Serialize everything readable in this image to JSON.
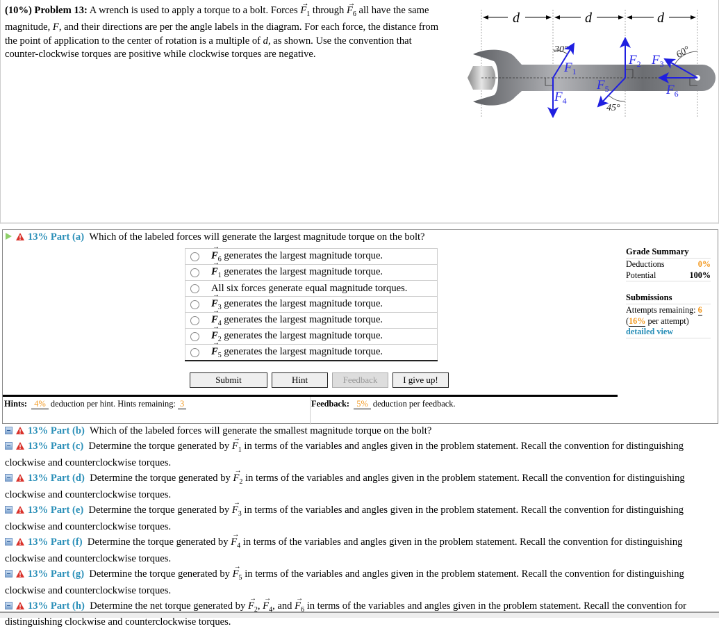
{
  "problem": {
    "prefix": "(10%) Problem 13:",
    "line1_a": "A wrench is used to apply a torque to a bolt. Forces",
    "line1_b": "through",
    "line1_c": "all have the same magnitude,",
    "line1_d": ", and their directions are per the angle labels in the diagram. For each force, the distance from the point of application to the center of rotation is a multiple of",
    "line1_e": ", as shown. Use the convention that counter-clockwise torques are positive while clockwise torques are negative.",
    "var_F": "F",
    "var_d": "d",
    "F1": "F",
    "F1_sub": "1",
    "F6": "F",
    "F6_sub": "6"
  },
  "diagram": {
    "distance_labels": [
      "d",
      "d",
      "d"
    ],
    "angles": [
      "30°",
      "45°",
      "60°"
    ],
    "forces": [
      {
        "label": "F",
        "sub": "1"
      },
      {
        "label": "F",
        "sub": "2"
      },
      {
        "label": "F",
        "sub": "3"
      },
      {
        "label": "F",
        "sub": "4"
      },
      {
        "label": "F",
        "sub": "5"
      },
      {
        "label": "F",
        "sub": "6"
      }
    ],
    "colors": {
      "force": "#1f1fe0",
      "wrench": "#8a8c90"
    }
  },
  "part_a": {
    "percent": "13%",
    "label": "Part (a)",
    "question": "Which of the labeled forces will generate the largest magnitude torque on the bolt?",
    "choices": [
      {
        "vec": "F",
        "sub": "6",
        "text": " generates the largest magnitude torque."
      },
      {
        "vec": "F",
        "sub": "1",
        "text": " generates the largest magnitude torque."
      },
      {
        "vec": "",
        "sub": "",
        "text": "All six forces generate equal magnitude torques."
      },
      {
        "vec": "F",
        "sub": "3",
        "text": " generates the largest magnitude torque."
      },
      {
        "vec": "F",
        "sub": "4",
        "text": " generates the largest magnitude torque."
      },
      {
        "vec": "F",
        "sub": "2",
        "text": " generates the largest magnitude torque."
      },
      {
        "vec": "F",
        "sub": "5",
        "text": " generates the largest magnitude torque."
      }
    ],
    "buttons": {
      "submit": "Submit",
      "hint": "Hint",
      "feedback": "Feedback",
      "give_up": "I give up!"
    },
    "hints": {
      "label": "Hints:",
      "deduction": "4%",
      "text": "deduction per hint. Hints remaining:",
      "remaining": "3"
    },
    "feedback": {
      "label": "Feedback:",
      "deduction": "5%",
      "text": "deduction per feedback."
    }
  },
  "grade_summary": {
    "title": "Grade Summary",
    "deductions_label": "Deductions",
    "deductions_value": "0%",
    "potential_label": "Potential",
    "potential_value": "100%",
    "submissions_title": "Submissions",
    "attempts_label": "Attempts remaining:",
    "attempts_value": "6",
    "per_attempt_open": "(",
    "per_attempt_value": "16%",
    "per_attempt_text": " per attempt)",
    "detailed_view": "detailed view"
  },
  "other_parts": [
    {
      "percent": "13%",
      "label": "Part (b)",
      "pre": "Which of the labeled forces will generate the smallest magnitude torque on the bolt?",
      "vecs": [],
      "post": ""
    },
    {
      "percent": "13%",
      "label": "Part (c)",
      "pre": "Determine the torque generated by",
      "vecs": [
        "1"
      ],
      "post": "in terms of the variables and angles given in the problem statement. Recall the convention for distinguishing clockwise and counterclockwise torques."
    },
    {
      "percent": "13%",
      "label": "Part (d)",
      "pre": "Determine the torque generated by",
      "vecs": [
        "2"
      ],
      "post": "in terms of the variables and angles given in the problem statement. Recall the convention for distinguishing clockwise and counterclockwise torques."
    },
    {
      "percent": "13%",
      "label": "Part (e)",
      "pre": "Determine the torque generated by",
      "vecs": [
        "3"
      ],
      "post": "in terms of the variables and angles given in the problem statement. Recall the convention for distinguishing clockwise and counterclockwise torques."
    },
    {
      "percent": "13%",
      "label": "Part (f)",
      "pre": "Determine the torque generated by",
      "vecs": [
        "4"
      ],
      "post": "in terms of the variables and angles given in the problem statement. Recall the convention for distinguishing clockwise and counterclockwise torques."
    },
    {
      "percent": "13%",
      "label": "Part (g)",
      "pre": "Determine the torque generated by",
      "vecs": [
        "5"
      ],
      "post": "in terms of the variables and angles given in the problem statement. Recall the convention for distinguishing clockwise and counterclockwise torques."
    },
    {
      "percent": "13%",
      "label": "Part (h)",
      "pre": "Determine the net torque generated by",
      "vecs": [
        "2",
        "4",
        "6"
      ],
      "post": "in terms of the variables and angles given in the problem statement. Recall the convention for distinguishing clockwise and counterclockwise torques."
    }
  ]
}
